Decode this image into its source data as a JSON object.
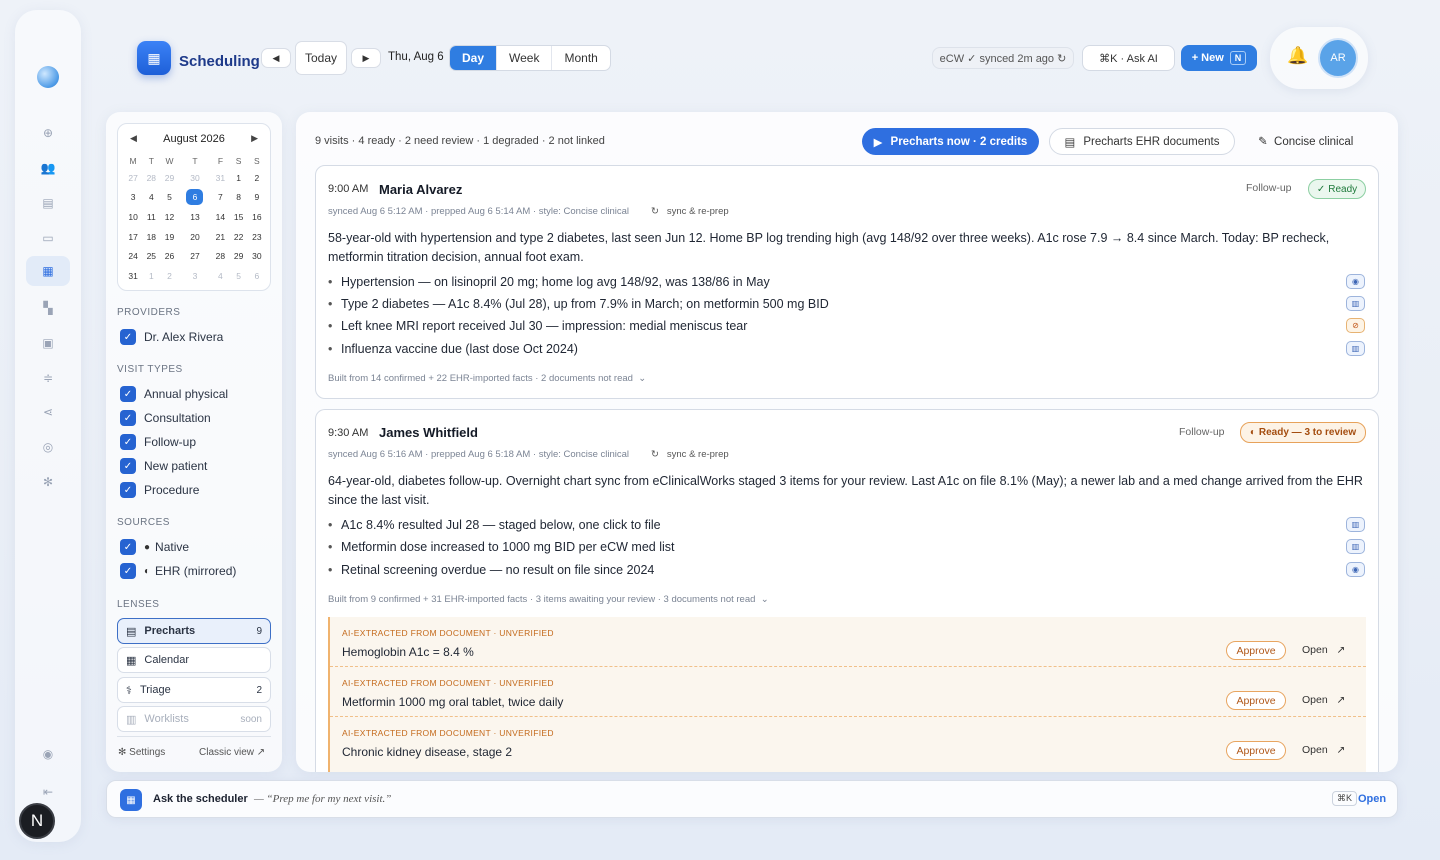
{
  "app": {
    "title": "Scheduling"
  },
  "topbar": {
    "today": "Today",
    "date": "Thu, Aug 6",
    "views": [
      "Day",
      "Week",
      "Month"
    ],
    "sync_status": "eCW ✓ synced 2m ago",
    "ask_ai": "⌘K · Ask AI",
    "new_label": "+ New",
    "new_shortcut": "N",
    "avatar": "AR"
  },
  "calendar": {
    "month": "August 2026",
    "dow": [
      "M",
      "T",
      "W",
      "T",
      "F",
      "S",
      "S"
    ],
    "weeks": [
      [
        "27",
        "28",
        "29",
        "30",
        "31",
        "1",
        "2"
      ],
      [
        "3",
        "4",
        "5",
        "6",
        "7",
        "8",
        "9"
      ],
      [
        "10",
        "11",
        "12",
        "13",
        "14",
        "15",
        "16"
      ],
      [
        "17",
        "18",
        "19",
        "20",
        "21",
        "22",
        "23"
      ],
      [
        "24",
        "25",
        "26",
        "27",
        "28",
        "29",
        "30"
      ],
      [
        "31",
        "1",
        "2",
        "3",
        "4",
        "5",
        "6"
      ]
    ],
    "selected": "6"
  },
  "filters": {
    "providers_title": "PROVIDERS",
    "providers": [
      "Dr. Alex Rivera"
    ],
    "visit_types_title": "VISIT TYPES",
    "visit_types": [
      "Annual physical",
      "Consultation",
      "Follow-up",
      "New patient",
      "Procedure"
    ],
    "sources_title": "SOURCES",
    "sources": [
      "Native",
      "EHR (mirrored)"
    ],
    "lenses_title": "LENSES",
    "lenses": [
      {
        "label": "Precharts",
        "count": "9"
      },
      {
        "label": "Calendar",
        "count": ""
      },
      {
        "label": "Triage",
        "count": "2"
      },
      {
        "label": "Worklists",
        "count": "soon"
      }
    ],
    "settings": "Settings",
    "classic": "Classic view"
  },
  "main": {
    "summary": "9 visits · 4 ready · 2 need review · 1 degraded · 2 not linked",
    "precharge_btn": "Precharts now · 2 credits",
    "precharge_docs": "Precharts EHR documents",
    "style": "Concise clinical"
  },
  "visits": [
    {
      "time": "9:00 AM",
      "name": "Maria Alvarez",
      "meta": "synced Aug 6 5:12 AM · prepped Aug 6 5:14 AM · style: Concise clinical",
      "resync": "sync & re-prep",
      "type": "Follow-up",
      "status": "Ready",
      "summary": "58-year-old with hypertension and type 2 diabetes, last seen Jun 12. Home BP log trending high (avg 148/92 over three weeks). A1c rose 7.9 → 8.4 since March. Today: BP recheck, metformin titration decision, annual foot exam.",
      "bullets": [
        "Hypertension — on lisinopril 20 mg; home log avg 148/92, was 138/86 in May",
        "Type 2 diabetes — A1c 8.4% (Jul 28), up from 7.9% in March; on metformin 500 mg BID",
        "Left knee MRI report received Jul 30 — impression: medial meniscus tear",
        "Influenza vaccine due (last dose Oct 2024)"
      ],
      "footer": "Built from 14 confirmed + 22 EHR-imported facts · 2 documents not read"
    },
    {
      "time": "9:30 AM",
      "name": "James Whitfield",
      "meta": "synced Aug 6 5:16 AM · prepped Aug 6 5:18 AM · style: Concise clinical",
      "resync": "sync & re-prep",
      "type": "Follow-up",
      "status": "Ready — 3 to review",
      "summary": "64-year-old, diabetes follow-up. Overnight chart sync from eClinicalWorks staged 3 items for your review. Last A1c on file 8.1% (May); a newer lab and a med change arrived from the EHR since the last visit.",
      "bullets": [
        "A1c 8.4% resulted Jul 28 — staged below, one click to file",
        "Metformin dose increased to 1000 mg BID per eCW med list",
        "Retinal screening overdue — no result on file since 2024"
      ],
      "footer": "Built from 9 confirmed + 31 EHR-imported facts · 3 items awaiting your review · 3 documents not read",
      "staged_label": "AI-EXTRACTED FROM DOCUMENT · UNVERIFIED",
      "staged": [
        "Hemoglobin A1c = 8.4 %",
        "Metformin 1000 mg oral tablet, twice daily",
        "Chronic kidney disease, stage 2"
      ],
      "approve": "Approve",
      "open": "Open"
    }
  ],
  "bottom": {
    "title": "Ask the scheduler",
    "hint": "“Prep me for my next visit.”",
    "shortcut": "⌘K",
    "open": "Open"
  }
}
